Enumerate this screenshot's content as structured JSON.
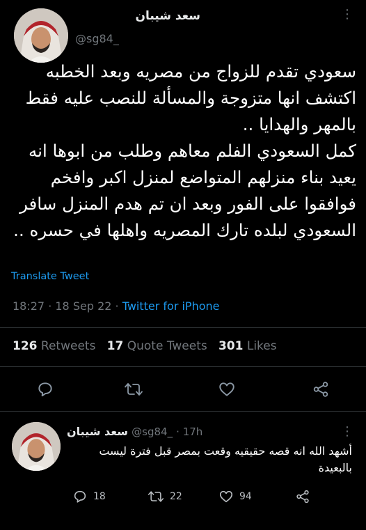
{
  "tweet": {
    "author_name": "سعد شيبان",
    "handle": "@sg84_",
    "text": "سعودي تقدم للزواج من مصريه وبعد الخطبه\nاكتشف انها متزوجة والمسألة للنصب عليه فقط\nبالمهر والهدايا ..\nكمل السعودي الفلم معاهم وطلب من ابوها انه\nيعيد بناء منزلهم المتواضع لمنزل اكبر وافخم\nفوافقوا على الفور وبعد ان تم هدم المنزل سافر\nالسعودي لبلده تارك المصريه واهلها في حسره ..",
    "translate_label": "Translate Tweet",
    "time": "18:27",
    "date": "18 Sep 22",
    "source": "Twitter for iPhone",
    "retweets_count": "126",
    "retweets_label": "Retweets",
    "quotes_count": "17",
    "quotes_label": "Quote Tweets",
    "likes_count": "301",
    "likes_label": "Likes"
  },
  "reply": {
    "author_name": "سعد شيبان",
    "handle": "@sg84_",
    "age": "· 17h",
    "text": "أشهد الله انه قصه حقيقيه وقعت بمصر قبل فترة ليست\nبالبعيدة",
    "replies": "18",
    "retweets": "22",
    "likes": "94"
  },
  "icons": {
    "reply": "reply-icon",
    "retweet": "retweet-icon",
    "like": "heart-icon",
    "share": "share-icon",
    "more": "more-icon"
  },
  "colors": {
    "background": "#000000",
    "link": "#1d9bf0",
    "muted": "#71767b"
  }
}
